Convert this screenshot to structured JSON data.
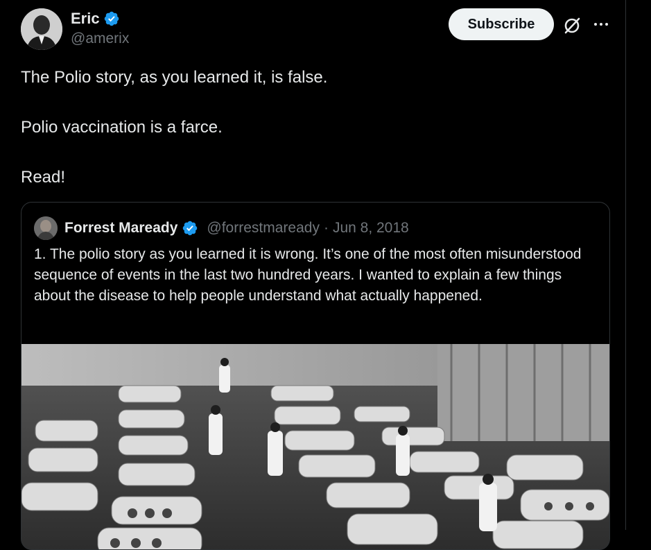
{
  "author": {
    "name": "Eric",
    "handle": "@amerix",
    "verified": true
  },
  "actions": {
    "subscribe_label": "Subscribe",
    "grok_icon": "grok-icon",
    "more_icon": "more-options-icon"
  },
  "tweet": {
    "paragraphs": [
      "The Polio story, as you learned it, is false.",
      "Polio vaccination is a farce.",
      "Read!"
    ]
  },
  "quoted_tweet": {
    "name": "Forrest Maready",
    "handle": "@forrestmaready",
    "separator": "·",
    "date": "Jun 8, 2018",
    "text": "1. The polio story as you learned it is wrong. It’s one of the most often misunderstood sequence of events in the last two hundred years. I wanted to explain a few things about the disease to help people understand what actually happened."
  },
  "colors": {
    "background": "#000000",
    "text": "#e7e9ea",
    "muted": "#71767b",
    "verified": "#1d9bf0",
    "subscribe_bg": "#eff3f4"
  }
}
